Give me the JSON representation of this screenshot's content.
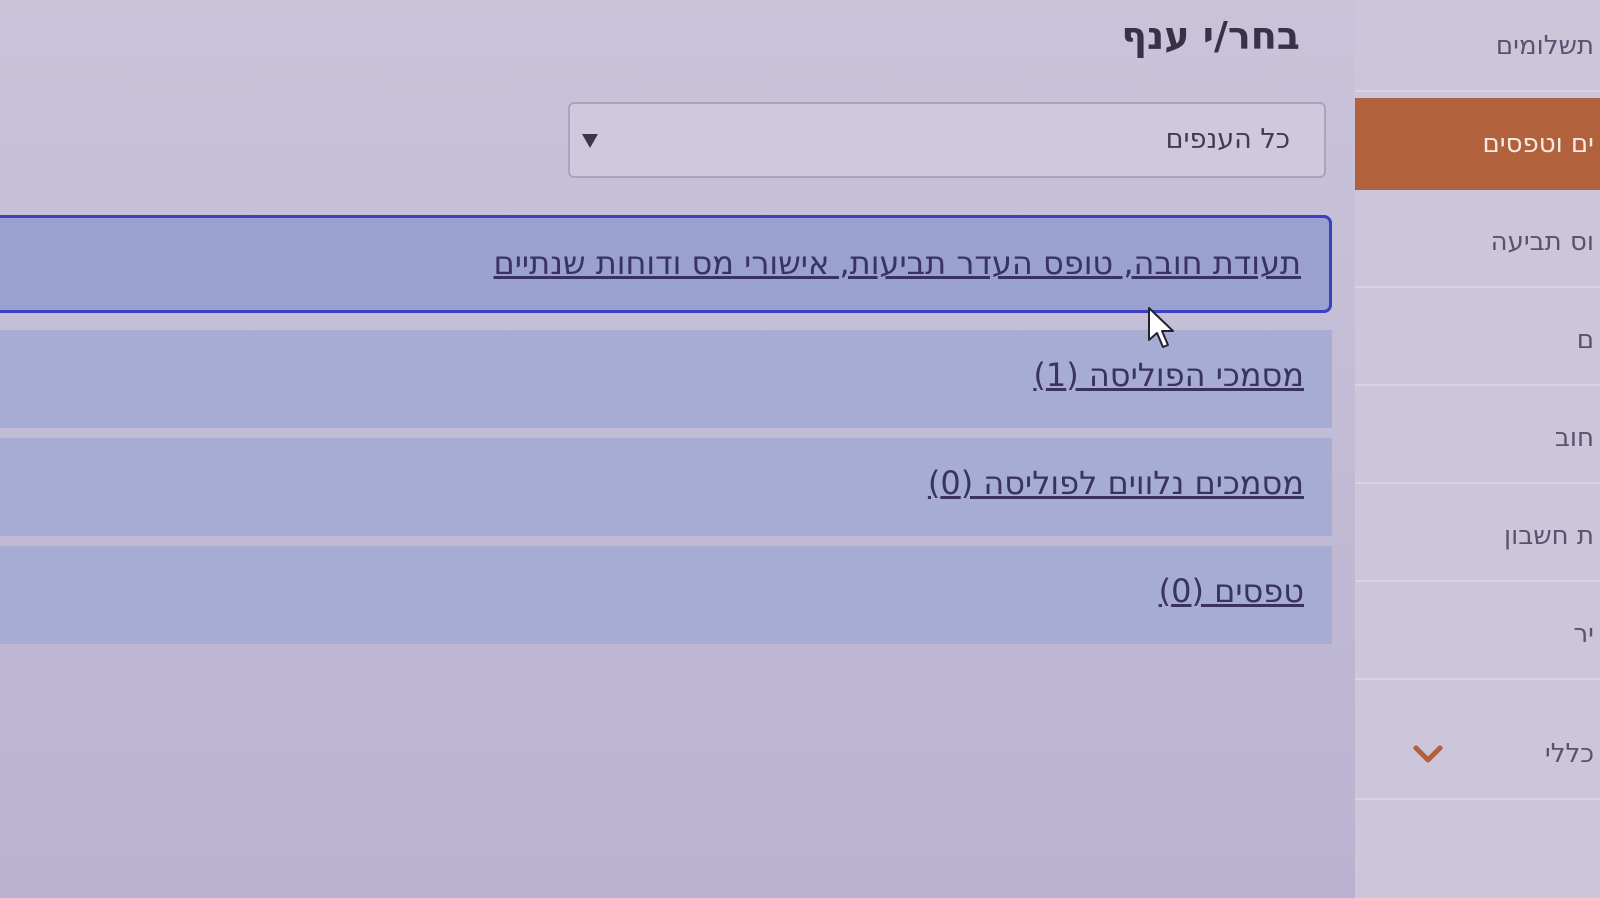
{
  "sidebar": {
    "items": [
      {
        "label": "תשלומים",
        "active": false
      },
      {
        "label": "ים וטפסים",
        "active": true
      },
      {
        "label": "וס תביעה",
        "active": false
      },
      {
        "label": "ם",
        "active": false
      },
      {
        "label": "חוב",
        "active": false
      },
      {
        "label": "ת חשבון",
        "active": false
      },
      {
        "label": "יר",
        "active": false
      },
      {
        "label": "כללי",
        "active": false,
        "has_chevron": true
      }
    ],
    "active_color": "#b1623c"
  },
  "main": {
    "title": "בחר/י ענף",
    "branch_select": {
      "selected": "כל הענפים"
    },
    "rows": [
      {
        "label": "תעודת חובה, טופס העדר תביעות, אישורי מס ודוחות שנתיים",
        "highlighted": true
      },
      {
        "label": "מסמכי הפוליסה (1)",
        "highlighted": false
      },
      {
        "label": "מסמכים נלווים לפוליסה (0)",
        "highlighted": false
      },
      {
        "label": "טפסים (0)",
        "highlighted": false
      }
    ]
  },
  "icons": {
    "dropdown": "triangle-down-icon",
    "sidebar_chevron": "chevron-down-icon",
    "cursor": "mouse-pointer-icon"
  },
  "colors": {
    "row_highlight_border": "#3b3fc0",
    "link_text": "#3a3260"
  }
}
